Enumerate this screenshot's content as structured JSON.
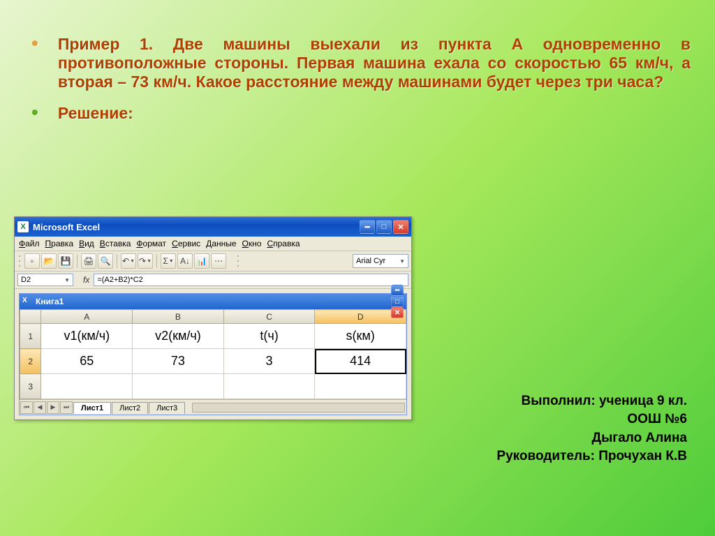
{
  "slide": {
    "problem": "Пример 1. Две машины выехали из пункта А одновременно в противоположные стороны. Первая машина ехала со скоростью 65 км/ч, а вторая – 73 км/ч. Какое расстояние между машинами будет через три часа?",
    "solution_label": "Решение:"
  },
  "credits": {
    "line1": "Выполнил: ученица 9 кл.",
    "line2": "ООШ №6",
    "line3": "Дыгало Алина",
    "line4": "Руководитель: Прочухан К.В"
  },
  "excel": {
    "app_title": "Microsoft Excel",
    "menu": [
      "Файл",
      "Правка",
      "Вид",
      "Вставка",
      "Формат",
      "Сервис",
      "Данные",
      "Окно",
      "Справка"
    ],
    "font_name": "Arial Cyr",
    "name_box": "D2",
    "formula": "=(A2+B2)*C2",
    "book_title": "Книга1",
    "columns": [
      "A",
      "B",
      "C",
      "D"
    ],
    "active_col_index": 3,
    "rows": [
      {
        "n": "1",
        "cells": [
          "v1(км/ч)",
          "v2(км/ч)",
          "t(ч)",
          "s(км)"
        ],
        "underline_first_chars": [
          2,
          2,
          1,
          1
        ]
      },
      {
        "n": "2",
        "cells": [
          "65",
          "73",
          "3",
          "414"
        ]
      },
      {
        "n": "3",
        "cells": [
          "",
          "",
          "",
          ""
        ]
      }
    ],
    "active_cell": {
      "row": 1,
      "col": 3
    },
    "sheets": [
      "Лист1",
      "Лист2",
      "Лист3"
    ],
    "active_sheet": 0
  },
  "icons": {
    "minimize": "━",
    "maximize": "□",
    "close": "✕",
    "new": "▫",
    "open": "📂",
    "save": "💾",
    "print": "🖨",
    "preview": "🔍",
    "undo": "↶",
    "sum": "Σ",
    "sort_asc": "A↓",
    "chart": "📊",
    "first": "⏮",
    "prev": "◀",
    "next": "▶",
    "last": "⏭"
  }
}
